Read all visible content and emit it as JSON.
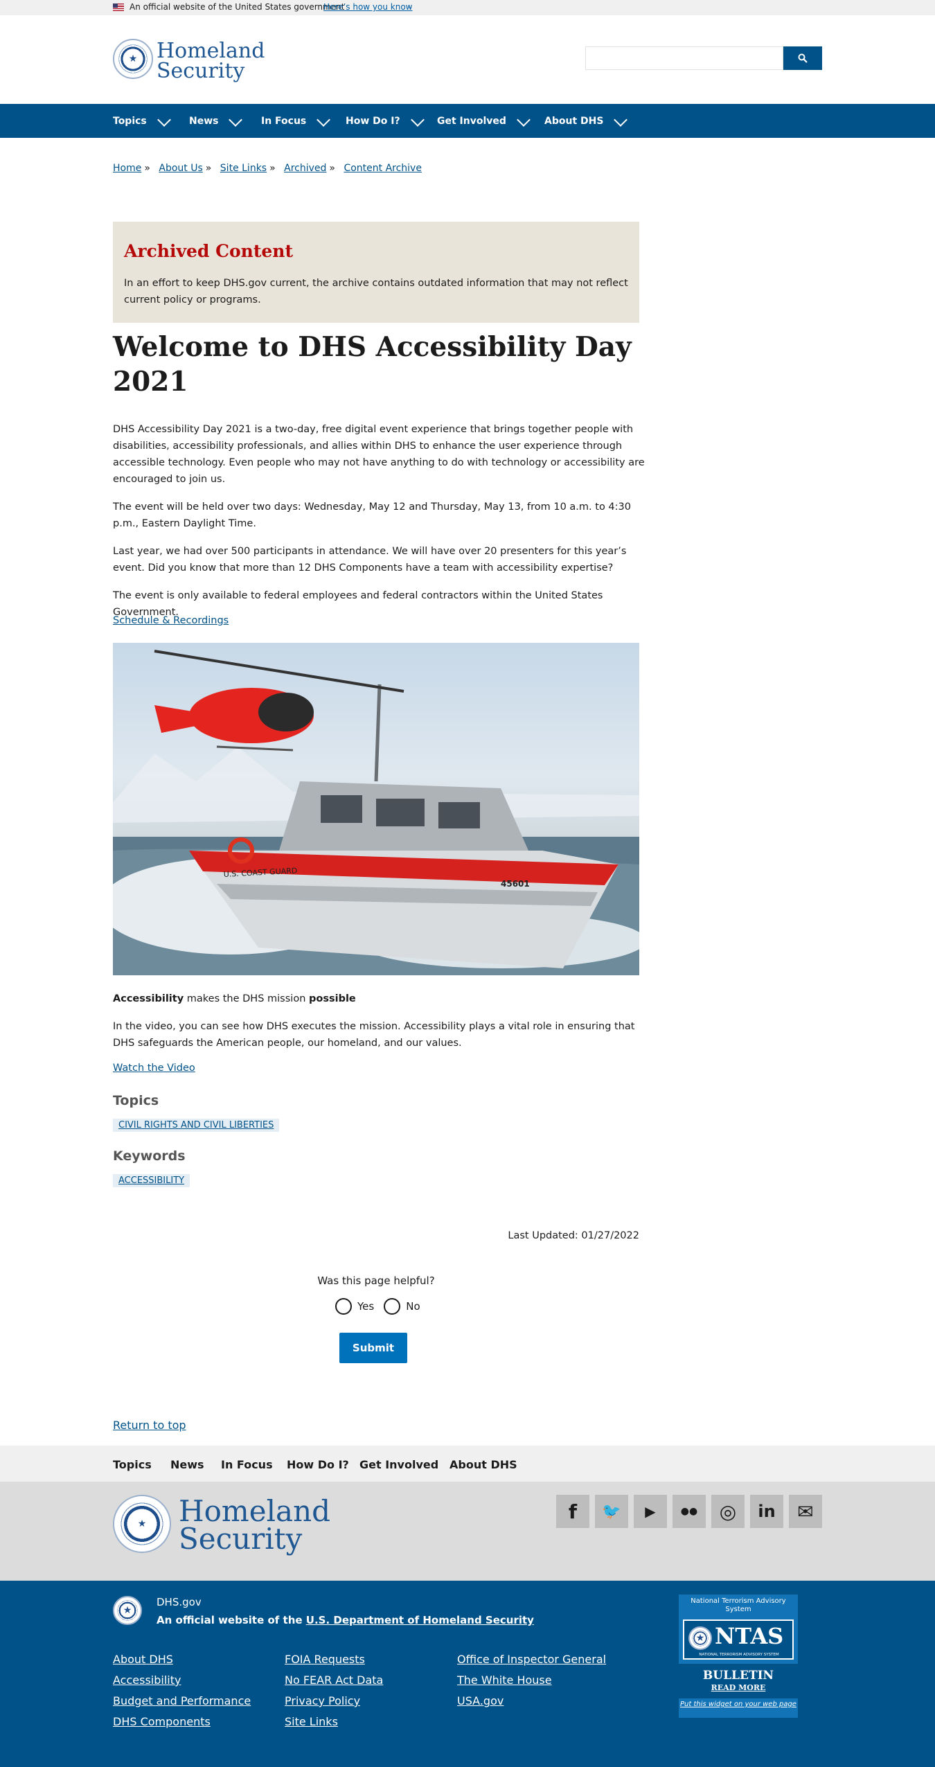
{
  "gov_banner": {
    "text": "An official website of the United States government",
    "link": "Here’s how you know"
  },
  "header": {
    "logo_line1": "Homeland",
    "logo_line2": "Security",
    "search_placeholder": ""
  },
  "nav": {
    "items": [
      "Topics",
      "News",
      "In Focus",
      "How Do I?",
      "Get Involved",
      "About DHS"
    ]
  },
  "breadcrumb": [
    "Home",
    "About Us",
    "Site Links",
    "Archived",
    "Content Archive"
  ],
  "breadcrumb_sep": "»",
  "archived": {
    "title": "Archived Content",
    "text": "In an effort to keep DHS.gov current, the archive contains outdated information that may not reflect current policy or programs."
  },
  "page_title": "Welcome to DHS Accessibility Day 2021",
  "paragraphs": [
    "DHS Accessibility Day 2021 is a two-day, free digital event experience that brings together people with disabilities, accessibility professionals, and allies within DHS to enhance the user experience through accessible technology. Even people who may not have anything to do with technology or accessibility are encouraged to join us.",
    "The event will be held over two days: Wednesday, May 12 and Thursday, May 13, from 10 a.m. to 4:30 p.m., Eastern Daylight Time.",
    "Last year, we had over 500 participants in attendance. We will have over 20 presenters for this year’s event. Did you know that more than 12 DHS Components have a team with accessibility expertise?",
    "The event is only available to federal employees and federal contractors within the United States Government."
  ],
  "schedule_link": "Schedule & Recordings",
  "photo_text": {
    "hull_label": "U.S. COAST GUARD",
    "boat_number": "45601"
  },
  "caption": {
    "bold1": "Accessibility",
    "middle": " makes the DHS mission ",
    "bold2": "possible"
  },
  "video_paragraph": "In the video, you can see how DHS executes the mission. Accessibility plays a vital role in ensuring that DHS safeguards the American people, our homeland, and our values.",
  "video_link": "Watch the Video",
  "topics": {
    "heading": "Topics",
    "tag": "CIVIL RIGHTS AND CIVIL LIBERTIES"
  },
  "keywords": {
    "heading": "Keywords",
    "tag": "ACCESSIBILITY"
  },
  "last_updated": "Last Updated: 01/27/2022",
  "feedback": {
    "question": "Was this page helpful?",
    "yes": "Yes",
    "no": "No",
    "submit": "Submit"
  },
  "return_top": "Return to top",
  "footer_nav": [
    "Topics",
    "News",
    "In Focus",
    "How Do I?",
    "Get Involved",
    "About DHS"
  ],
  "footer_logo": {
    "line1": "Homeland",
    "line2": "Security"
  },
  "social": [
    {
      "name": "facebook-icon",
      "glyph": "f"
    },
    {
      "name": "twitter-icon",
      "glyph": "🐦"
    },
    {
      "name": "youtube-icon",
      "glyph": "▶"
    },
    {
      "name": "flickr-icon",
      "glyph": "●●"
    },
    {
      "name": "instagram-icon",
      "glyph": "◎"
    },
    {
      "name": "linkedin-icon",
      "glyph": "in"
    },
    {
      "name": "email-icon",
      "glyph": "✉"
    }
  ],
  "footer_identity": {
    "domain": "DHS.gov",
    "official_prefix": "An official website of the ",
    "official_link": "U.S. Department of Homeland Security"
  },
  "footer_links": [
    [
      "About DHS",
      "Accessibility",
      "Budget and Performance",
      "DHS Components"
    ],
    [
      "FOIA Requests",
      "No FEAR Act Data",
      "Privacy Policy",
      "Site Links"
    ],
    [
      "Office of Inspector General",
      "The White House",
      "USA.gov"
    ]
  ],
  "ntas": {
    "header": "National Terrorism Advisory System",
    "logo": "NTAS",
    "logo_sub": "NATIONAL TERRORISM ADVISORY SYSTEM",
    "bulletin": "BULLETIN",
    "read_more": "READ MORE",
    "widget": "Put this widget on your web page"
  }
}
